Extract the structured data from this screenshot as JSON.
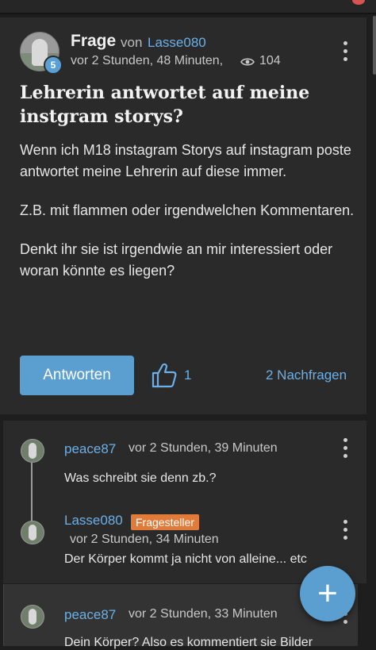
{
  "question": {
    "type_label": "Frage",
    "by_label": "von",
    "author": "Lasse080",
    "level": "5",
    "time": "vor 2 Stunden, 48 Minuten,",
    "views": "104",
    "title": "Lehrerin antwortet auf meine instgram storys?",
    "paragraphs": [
      "Wenn ich M18 instagram Storys auf instagram poste antwortet meine Lehrerin auf diese immer.",
      "Z.B. mit flammen oder irgendwelchen Kommentaren.",
      "Denkt ihr sie ist irgendwie an mir interessiert oder woran könnte es liegen?"
    ],
    "answer_button": "Antworten",
    "likes": "1",
    "followups": "2 Nachfragen"
  },
  "comments": [
    {
      "author": "peace87",
      "time": "vor 2 Stunden, 39 Minuten",
      "text": "Was schreibt sie denn zb.?"
    },
    {
      "author": "Lasse080",
      "badge": "Fragesteller",
      "time": "vor 2 Stunden, 34 Minuten",
      "text": "Der Körper kommt ja nicht von alleine... etc"
    },
    {
      "author": "peace87",
      "time": "vor 2 Stunden, 33 Minuten",
      "text": "Dein Körper? Also es kommentiert sie Bilder"
    }
  ],
  "fab_label": "+",
  "icons": [
    "eye-icon",
    "thumbs-up-icon",
    "more-vert-icon",
    "plus-icon"
  ],
  "colors": {
    "accent": "#5b9fd1",
    "link": "#6bb0e8",
    "badge": "#e07b3a",
    "background": "#1e1e1e",
    "card": "#2a2a2a"
  }
}
